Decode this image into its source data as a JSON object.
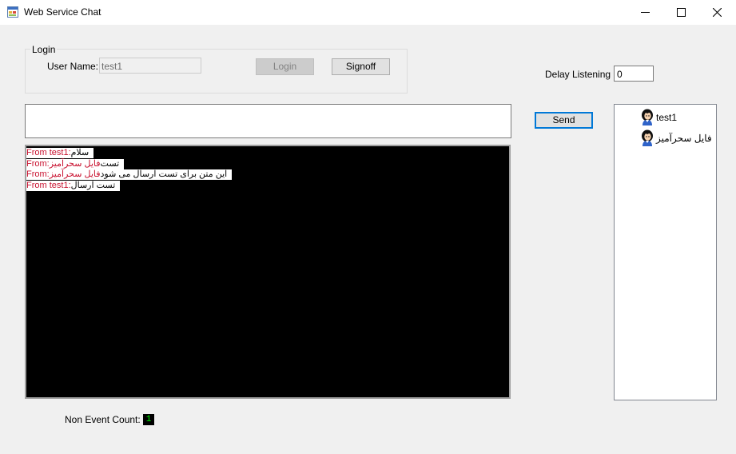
{
  "window": {
    "title": "Web Service Chat"
  },
  "login": {
    "group_label": "Login",
    "username_label": "User Name:",
    "username_value": "test1",
    "login_button": "Login",
    "signoff_button": "Signoff"
  },
  "delay": {
    "label": "Delay Listening",
    "value": "0"
  },
  "message_input": {
    "value": ""
  },
  "send_button": "Send",
  "chat": {
    "messages": [
      {
        "from": "From test1:",
        "text": "سلام"
      },
      {
        "from": "From ",
        "sender": "فایل سحرآمیز:",
        "text": "تست"
      },
      {
        "from": "From ",
        "sender": "فایل سحرآمیز:",
        "text": "این متن برای تست ارسال می شود"
      },
      {
        "from": "From test1:",
        "text": "تست ارسال"
      }
    ]
  },
  "users": [
    {
      "name": "test1",
      "icon": "user-avatar-icon"
    },
    {
      "name": "فایل سحرآمیز",
      "icon": "user-avatar-icon"
    }
  ],
  "status": {
    "non_event_label": "Non Event Count:",
    "non_event_value": "1"
  },
  "colors": {
    "accent": "#0078d7",
    "chat_background": "#000000",
    "sender_color": "#c8102e",
    "counter_text": "#00ff00"
  }
}
